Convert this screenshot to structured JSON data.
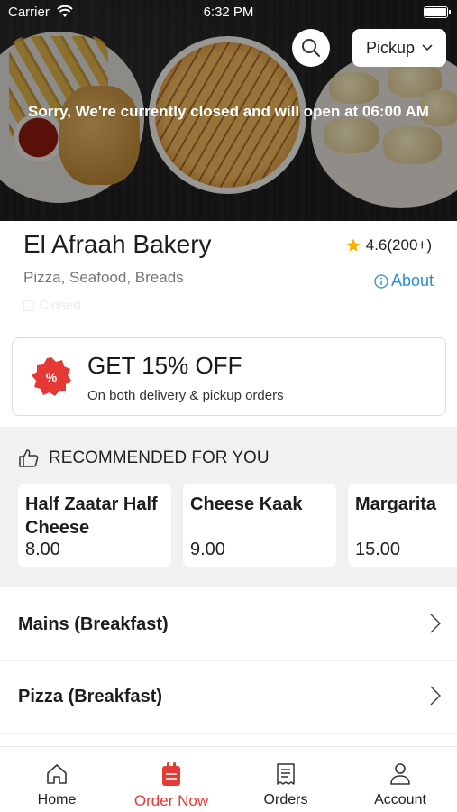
{
  "status_bar": {
    "carrier": "Carrier",
    "time": "6:32 PM"
  },
  "header": {
    "pickup_label": "Pickup",
    "closed_message": "Sorry, We're currently closed and will open at 06:00 AM"
  },
  "store": {
    "name": "El Afraah Bakery",
    "rating": "4.6(200+)",
    "cuisines": "Pizza, Seafood, Breads",
    "about_label": "About",
    "status": "Closed"
  },
  "promo": {
    "title": "GET 15% OFF",
    "subtitle": "On both delivery & pickup orders",
    "badge_color": "#e53935"
  },
  "recommended": {
    "heading": "RECOMMENDED FOR YOU",
    "items": [
      {
        "name": "Half Zaatar Half Cheese",
        "price": "8.00"
      },
      {
        "name": "Cheese Kaak",
        "price": "9.00"
      },
      {
        "name": "Margarita",
        "price": "15.00"
      }
    ]
  },
  "categories": [
    {
      "label": "Mains (Breakfast)"
    },
    {
      "label": "Pizza (Breakfast)"
    }
  ],
  "tabs": [
    {
      "label": "Home",
      "icon": "home-icon"
    },
    {
      "label": "Order Now",
      "icon": "order-bag-icon",
      "active": true
    },
    {
      "label": "Orders",
      "icon": "receipt-icon"
    },
    {
      "label": "Account",
      "icon": "person-icon"
    }
  ],
  "colors": {
    "accent": "#e53935",
    "link": "#2b8fd6",
    "star": "#f5b400"
  }
}
